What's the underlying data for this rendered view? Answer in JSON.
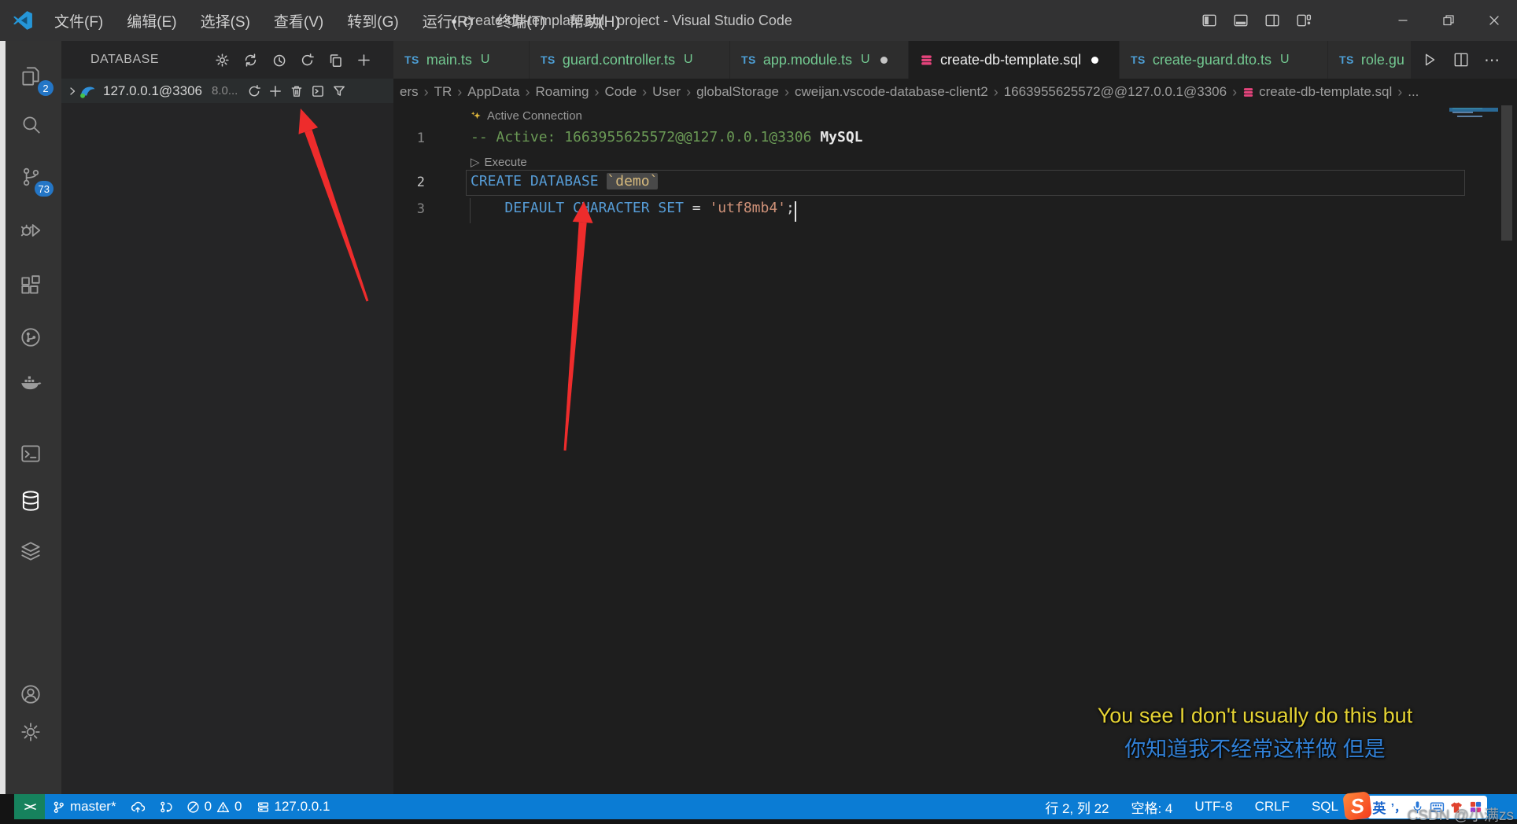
{
  "titlebar": {
    "menus": [
      "文件(F)",
      "编辑(E)",
      "选择(S)",
      "查看(V)",
      "转到(G)",
      "运行(R)",
      "终端(T)",
      "帮助(H)"
    ],
    "dirty_dot": "●",
    "title": "create-db-template.sql - project - Visual Studio Code"
  },
  "activity_bar": {
    "explorer_badge": "2",
    "scm_badge": "73"
  },
  "sidebar": {
    "title": "DATABASE",
    "connection": {
      "name": "127.0.0.1@3306",
      "version": "8.0..."
    }
  },
  "tabs": [
    {
      "icon_label": "TS",
      "label": "main.ts",
      "git": "U"
    },
    {
      "icon_label": "TS",
      "label": "guard.controller.ts",
      "git": "U"
    },
    {
      "icon_label": "TS",
      "label": "app.module.ts",
      "git": "U"
    },
    {
      "icon_label": "SQL",
      "label": "create-db-template.sql",
      "git": ""
    },
    {
      "icon_label": "TS",
      "label": "create-guard.dto.ts",
      "git": "U"
    },
    {
      "icon_label": "TS",
      "label": "role.gu",
      "git": ""
    }
  ],
  "breadcrumb": {
    "separator": "›",
    "items": [
      "ers",
      "TR",
      "AppData",
      "Roaming",
      "Code",
      "User",
      "globalStorage",
      "cweijan.vscode-database-client2",
      "1663955625572@@127.0.0.1@3306",
      "create-db-template.sql",
      "..."
    ]
  },
  "code": {
    "lens_connection": "Active Connection",
    "lens_execute": "Execute",
    "lens_execute_glyph": "▷",
    "line1": {
      "num": "1",
      "comment": "-- Active: 1663955625572@@127.0.0.1@3306",
      "lang": "MySQL"
    },
    "line2": {
      "num": "2",
      "keyword": "CREATE DATABASE",
      "name": "`demo`"
    },
    "line3": {
      "num": "3",
      "indent": "    ",
      "keyword": "DEFAULT CHARACTER SET",
      "operator": "=",
      "string": "'utf8mb4'",
      "semi": ";"
    }
  },
  "status_bar": {
    "remote_glyph": "><",
    "branch": "master*",
    "errors": "0",
    "warnings": "0",
    "server": "127.0.0.1",
    "cursor_position": "行 2, 列 22",
    "indentation": "空格: 4",
    "encoding": "UTF-8",
    "eol": "CRLF",
    "language": "SQL",
    "ime": {
      "logo": "S",
      "lang": "英",
      "punct": "’，"
    }
  },
  "subtitles": {
    "en": "You see I don't usually do this but",
    "zh": "你知道我不经常这样做 但是"
  },
  "watermark": "CSDN @小满zs",
  "colors": {
    "statusbar_blue": "#0b7cd4",
    "remote_green": "#16825d",
    "arrow_red": "#ee2c2c",
    "git_untracked_green": "#73c991",
    "sql_icon_pink": "#e5447c",
    "keyword_blue": "#569cd6",
    "comment_green": "#6a9955",
    "string_orange": "#ce9178"
  }
}
